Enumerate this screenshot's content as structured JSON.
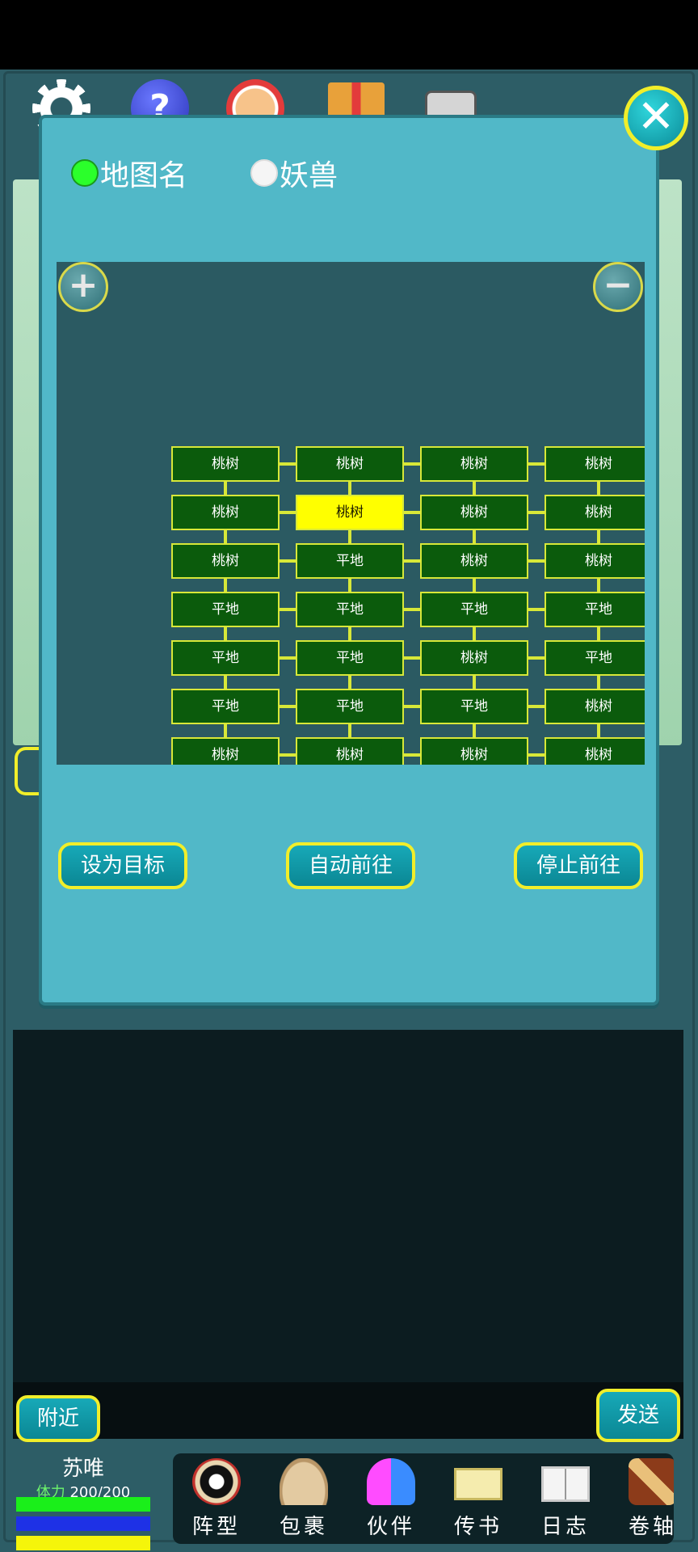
{
  "dialog": {
    "radio_map_label": "地图名",
    "radio_beast_label": "妖兽",
    "zoom_in": "+",
    "zoom_out": "−",
    "close": "✕",
    "buttons": {
      "set_target": "设为目标",
      "auto_go": "自动前往",
      "stop_go": "停止前往"
    },
    "map_rows": [
      [
        "桃树",
        "桃树",
        "桃树",
        "桃树"
      ],
      [
        "桃树",
        "桃树",
        "桃树",
        "桃树"
      ],
      [
        "桃树",
        "平地",
        "桃树",
        "桃树"
      ],
      [
        "平地",
        "平地",
        "平地",
        "平地"
      ],
      [
        "平地",
        "平地",
        "桃树",
        "平地"
      ],
      [
        "平地",
        "平地",
        "平地",
        "桃树"
      ],
      [
        "桃树",
        "桃树",
        "桃树",
        "桃树"
      ]
    ],
    "current_cell": {
      "row": 1,
      "col": 1
    }
  },
  "top_icons": {
    "help_glyph": "?"
  },
  "chat": {
    "nearby_label": "附近",
    "send_label": "发送"
  },
  "player": {
    "name": "苏唯",
    "stamina_label": "体力",
    "stamina_value": "200/200"
  },
  "nav": [
    {
      "label": "阵型",
      "icon": "formation-icon"
    },
    {
      "label": "包裹",
      "icon": "bag-icon"
    },
    {
      "label": "伙伴",
      "icon": "partner-icon"
    },
    {
      "label": "传书",
      "icon": "mail-icon"
    },
    {
      "label": "日志",
      "icon": "log-icon"
    },
    {
      "label": "卷轴",
      "icon": "scroll-icon"
    }
  ],
  "colors": {
    "dialog_bg": "#51b8c8",
    "map_bg": "#2b5a62",
    "cell_bg": "#0b5b0c",
    "cell_current": "#ffff00",
    "button_border": "#f1ee2a"
  }
}
